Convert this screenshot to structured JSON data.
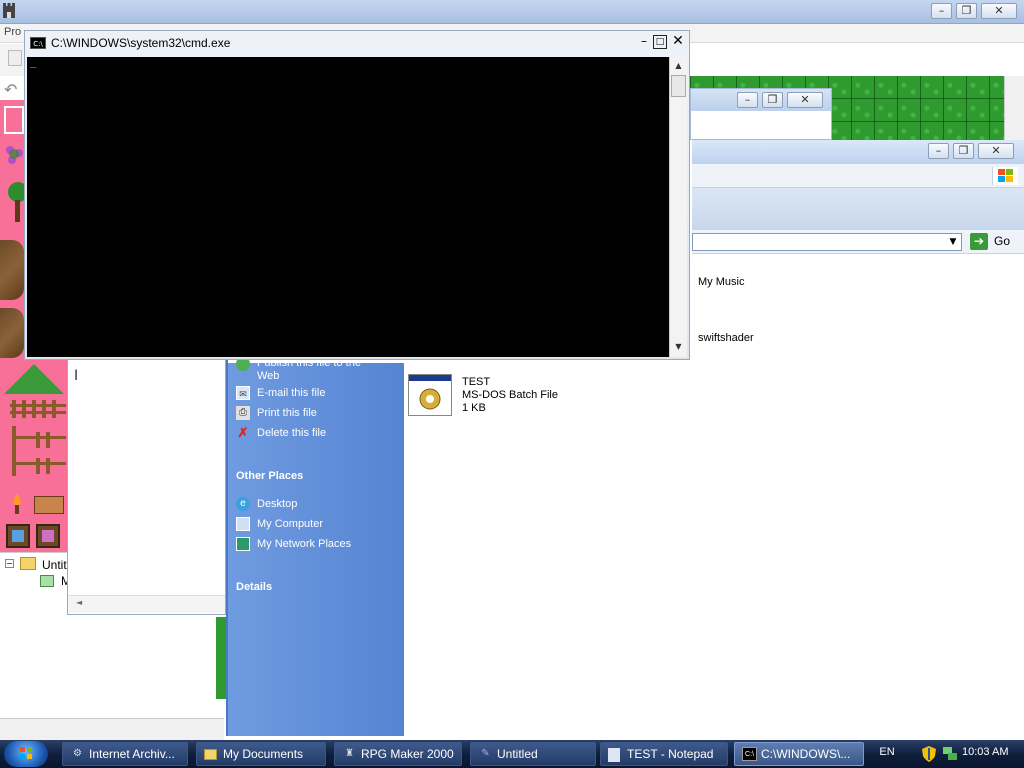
{
  "rpg_maker": {
    "menu_partial": "Pro"
  },
  "cmd": {
    "title": "C:\\WINDOWS\\system32\\cmd.exe",
    "cursor": "_"
  },
  "explorer": {
    "go_label": "Go",
    "task_pane": {
      "items": [
        {
          "label": "Publish this file to the Web",
          "icon": "publish-icon"
        },
        {
          "label": "E-mail this file",
          "icon": "email-icon"
        },
        {
          "label": "Print this file",
          "icon": "print-icon"
        },
        {
          "label": "Delete this file",
          "icon": "delete-icon"
        }
      ],
      "other_places_title": "Other Places",
      "other_places": [
        {
          "label": "Desktop",
          "icon": "desktop-icon"
        },
        {
          "label": "My Computer",
          "icon": "my-computer-icon"
        },
        {
          "label": "My Network Places",
          "icon": "network-places-icon"
        }
      ],
      "details_title": "Details"
    },
    "files": [
      {
        "name": "My Music"
      },
      {
        "name": "swiftshader"
      }
    ],
    "selected_file": {
      "name": "TEST",
      "type": "MS-DOS Batch File",
      "size": "1 KB"
    }
  },
  "map_tree": {
    "root_label": "Untitl",
    "child_label": "M"
  },
  "taskbar": {
    "items": [
      {
        "label": "Internet Archiv...",
        "icon": "internet-archive-icon"
      },
      {
        "label": "My Documents",
        "icon": "folder-icon"
      },
      {
        "label": "RPG Maker 2000",
        "icon": "rpg-maker-icon"
      },
      {
        "label": "Untitled",
        "icon": "paint-icon"
      },
      {
        "label": "TEST - Notepad",
        "icon": "notepad-icon"
      },
      {
        "label": "C:\\WINDOWS\\...",
        "icon": "cmd-icon"
      }
    ],
    "language": "EN",
    "clock": "10:03 AM"
  },
  "colors": {
    "task_pane": "#5584d2",
    "taskbar": "#0d1d3a",
    "cmd_body": "#000000",
    "palette_bg": "#f87098",
    "grass": "#2f9a2f"
  }
}
